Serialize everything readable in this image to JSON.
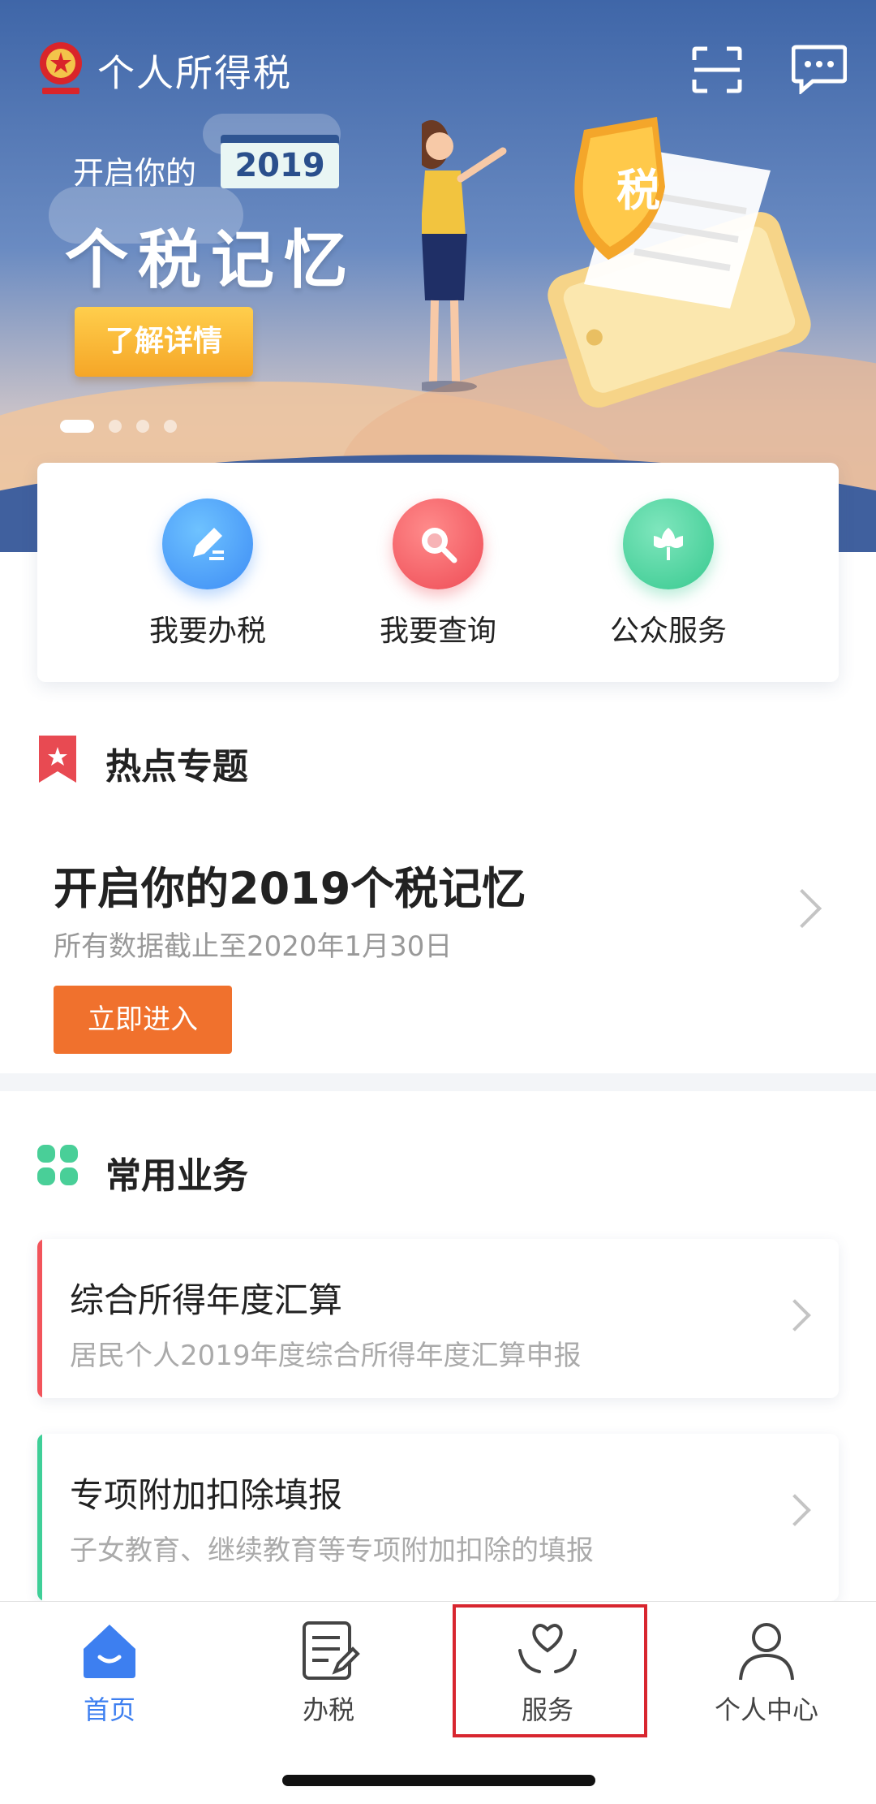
{
  "header": {
    "app_title": "个人所得税",
    "icons": [
      "national-emblem-icon",
      "scan-icon",
      "message-icon"
    ]
  },
  "banner": {
    "line1": "开启你的",
    "year": "2019",
    "title": "个税记忆",
    "cta_label": "了解详情",
    "badge_text": "税",
    "slide_count": 4,
    "active_slide": 1
  },
  "quick_actions": [
    {
      "label": "我要办税",
      "icon": "edit-icon",
      "color": "#3d9bf5"
    },
    {
      "label": "我要查询",
      "icon": "search-icon",
      "color": "#f2545b"
    },
    {
      "label": "公众服务",
      "icon": "flower-icon",
      "color": "#3fcf98"
    }
  ],
  "hot_topics": {
    "section_title": "热点专题",
    "item_title": "开启你的2019个税记忆",
    "item_subtitle": "所有数据截止至2020年1月30日",
    "button_label": "立即进入"
  },
  "common_tasks": {
    "section_title": "常用业务",
    "items": [
      {
        "title": "综合所得年度汇算",
        "subtitle": "居民个人2019年度综合所得年度汇算申报",
        "accent": "#f2545b"
      },
      {
        "title": "专项附加扣除填报",
        "subtitle": "子女教育、继续教育等专项附加扣除的填报",
        "accent": "#3fcf98"
      }
    ]
  },
  "bottom_nav": {
    "items": [
      {
        "label": "首页",
        "icon": "home-icon",
        "active": true
      },
      {
        "label": "办税",
        "icon": "tax-form-icon",
        "active": false
      },
      {
        "label": "服务",
        "icon": "service-heart-icon",
        "active": false
      },
      {
        "label": "个人中心",
        "icon": "user-icon",
        "active": false
      }
    ],
    "active_color": "#3d7ff0",
    "inactive_color": "#444444",
    "highlighted_item": "服务"
  }
}
